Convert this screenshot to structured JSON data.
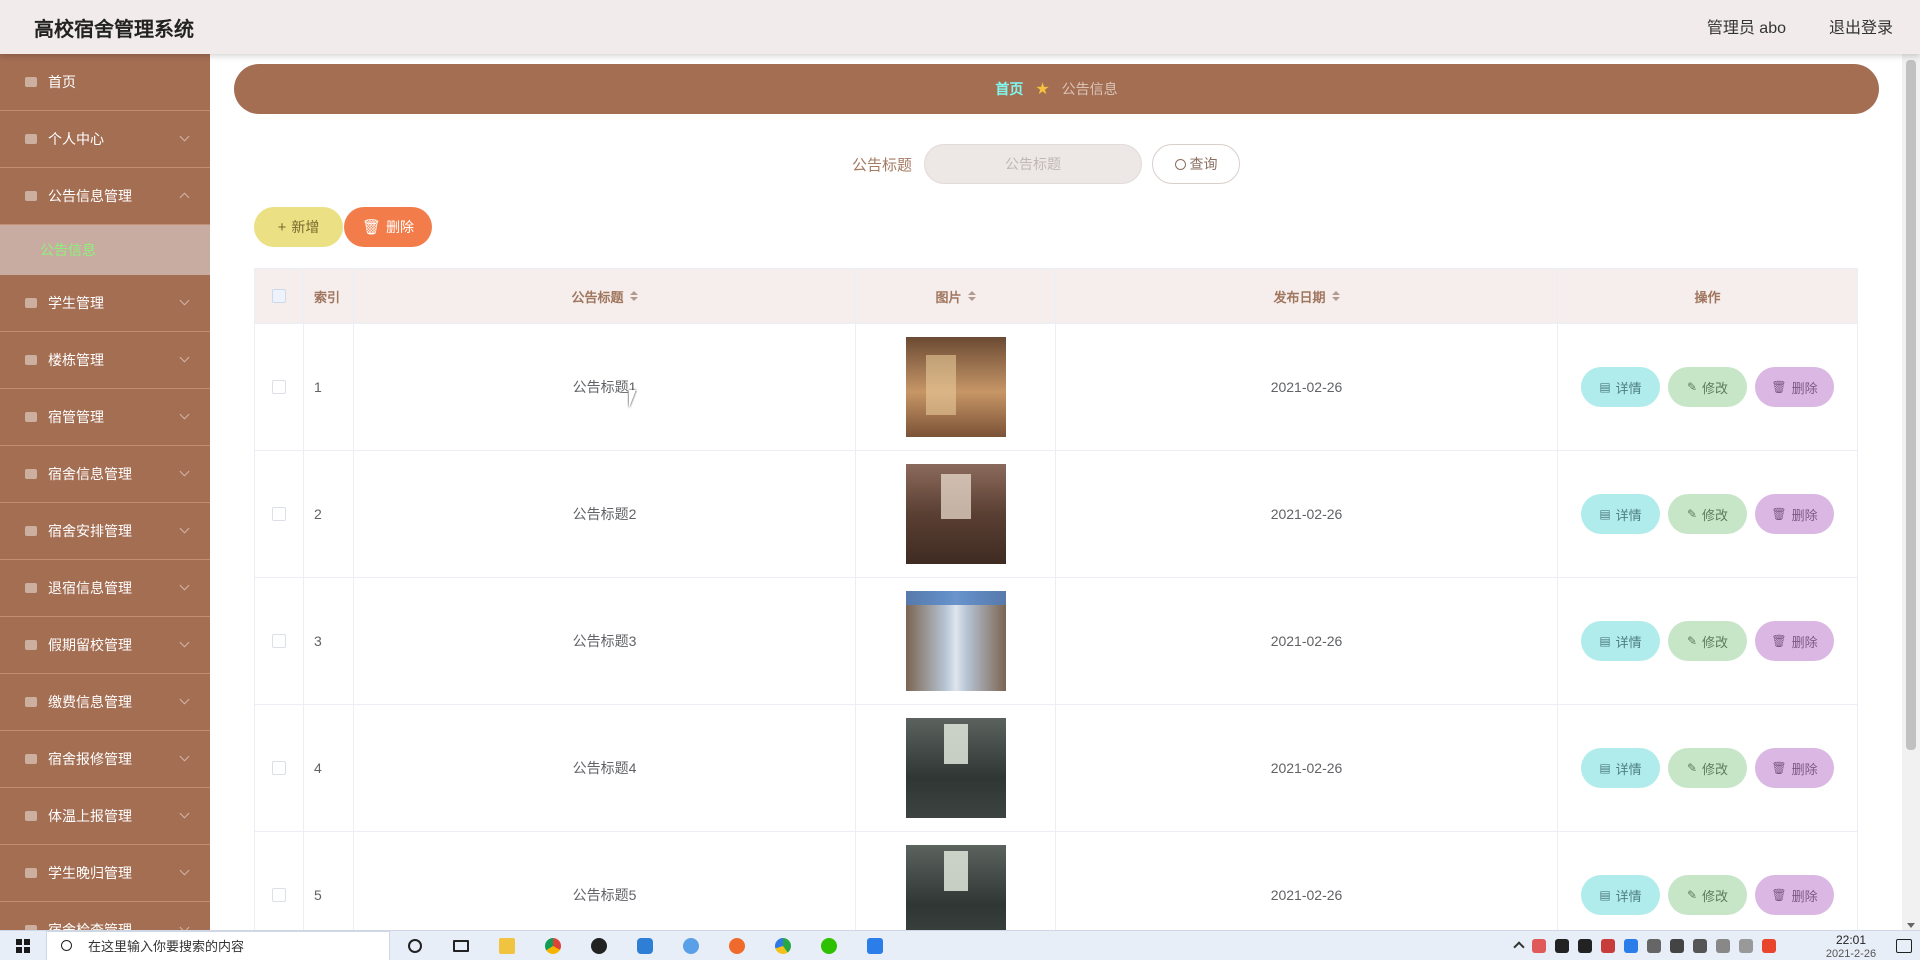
{
  "app": {
    "title": "高校宿舍管理系统",
    "user_label": "管理员 abo",
    "logout_label": "退出登录"
  },
  "sidebar": {
    "items": [
      {
        "label": "首页",
        "icon": "home-icon"
      },
      {
        "label": "个人中心",
        "icon": "user-icon"
      },
      {
        "label": "公告信息管理",
        "icon": "monitor-icon"
      },
      {
        "label": "学生管理",
        "icon": "sliders-icon"
      },
      {
        "label": "楼栋管理",
        "icon": "phone-icon"
      },
      {
        "label": "宿管管理",
        "icon": "send-icon"
      },
      {
        "label": "宿舍信息管理",
        "icon": "bar-chart-icon"
      },
      {
        "label": "宿舍安排管理",
        "icon": "calendar-icon"
      },
      {
        "label": "退宿信息管理",
        "icon": "stats-icon"
      },
      {
        "label": "假期留校管理",
        "icon": "microphone-icon"
      },
      {
        "label": "缴费信息管理",
        "icon": "card-icon"
      },
      {
        "label": "宿舍报修管理",
        "icon": "settings-icon"
      },
      {
        "label": "体温上报管理",
        "icon": "location-icon"
      },
      {
        "label": "学生晚归管理",
        "icon": "clock-icon"
      },
      {
        "label": "宿舍检查管理",
        "icon": "check-icon"
      }
    ],
    "submenu": {
      "label": "公告信息"
    }
  },
  "breadcrumb": {
    "home": "首页",
    "current": "公告信息"
  },
  "search": {
    "label": "公告标题",
    "placeholder": "公告标题",
    "button": "查询"
  },
  "actions": {
    "add": "新增",
    "delete": "删除"
  },
  "table": {
    "headers": {
      "index": "索引",
      "title": "公告标题",
      "image": "图片",
      "date": "发布日期",
      "ops": "操作"
    },
    "rows": [
      {
        "index": "1",
        "title": "公告标题1",
        "date": "2021-02-26"
      },
      {
        "index": "2",
        "title": "公告标题2",
        "date": "2021-02-26"
      },
      {
        "index": "3",
        "title": "公告标题3",
        "date": "2021-02-26"
      },
      {
        "index": "4",
        "title": "公告标题4",
        "date": "2021-02-26"
      },
      {
        "index": "5",
        "title": "公告标题5",
        "date": "2021-02-26"
      }
    ],
    "op_labels": {
      "detail": "详情",
      "edit": "修改",
      "delete": "删除"
    }
  },
  "taskbar": {
    "search_placeholder": "在这里输入你要搜索的内容",
    "time": "22:01",
    "date": "2021-2-26"
  },
  "colors": {
    "sidebar": "#a46e53",
    "breadcrumb_bg": "#a46e53",
    "add_button": "#ece084",
    "delete_button": "#f27d4a",
    "detail_button": "#b1ecec",
    "edit_button": "#c7e6c8",
    "remove_button": "#dbb7e3"
  }
}
